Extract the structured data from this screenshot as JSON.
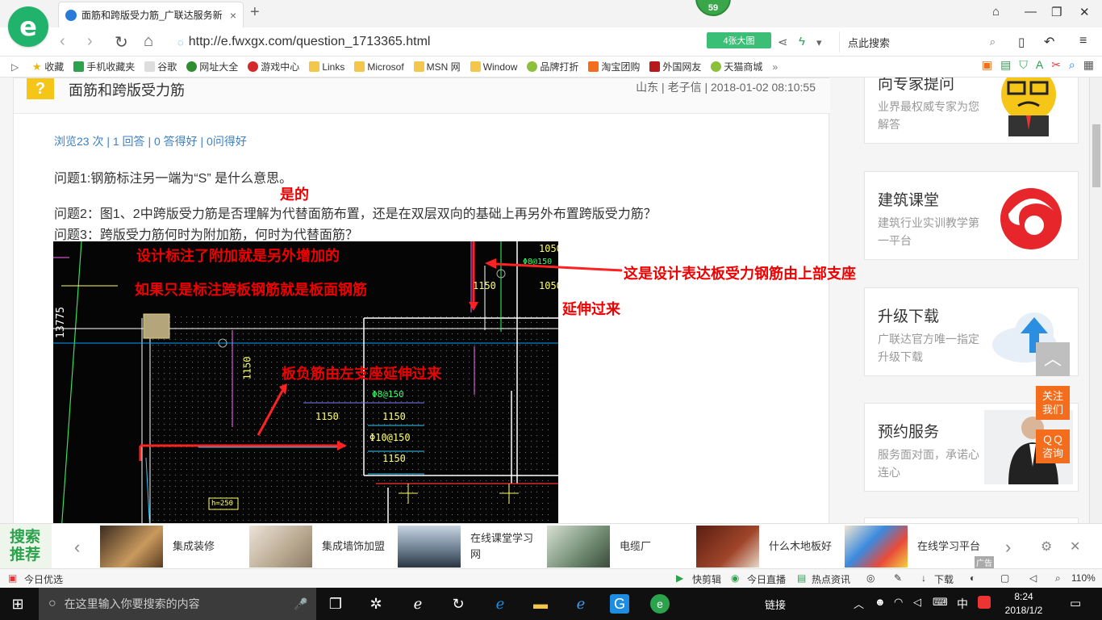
{
  "browser": {
    "tab_title": "面筋和跨版受力筋_广联达服务新",
    "notif_count": "59",
    "url": "http://e.fwxgx.com/question_1713365.html",
    "bigpic_label": "4张大图",
    "search_placeholder": "点此搜索"
  },
  "bookmarks": [
    {
      "label": "收藏"
    },
    {
      "label": "手机收藏夹"
    },
    {
      "label": "谷歌"
    },
    {
      "label": "网址大全"
    },
    {
      "label": "游戏中心"
    },
    {
      "label": "Links"
    },
    {
      "label": "Microsof"
    },
    {
      "label": "MSN 网"
    },
    {
      "label": "Window"
    },
    {
      "label": "品牌打折"
    },
    {
      "label": "淘宝团购"
    },
    {
      "label": "外国网友"
    },
    {
      "label": "天猫商城"
    }
  ],
  "question": {
    "title": "面筋和跨版受力筋",
    "meta": "山东 | 老子信 | 2018-01-02 08:10:55",
    "stats": "浏览23 次 | 1 回答 | 0 答得好 | 0问得好",
    "q1": "问题1:钢筋标注另一端为“S” 是什么意思。",
    "q2": "问题2：图1、2中跨版受力筋是否理解为代替面筋布置，还是在双层双向的基础上再另外布置跨版受力筋？",
    "q3": "问题3：跨版受力筋何时为附加筋，何时为代替面筋？"
  },
  "annotations": {
    "a_yes": "是的",
    "a_design1": "设计标注了附加就是另外增加的",
    "a_design2": "如果只是标注跨板钢筋就是板面钢筋",
    "a_upper": "这是设计表达板受力钢筋由上部支座",
    "a_extend": "延伸过来",
    "a_left": "板负筋由左支座延伸过来"
  },
  "cad": {
    "dim_13775": "13775",
    "dim_1050a": "1050",
    "dim_1050b": "1050",
    "dim_1150a": "1150",
    "dim_1150b": "1150",
    "dim_1150c": "1150",
    "dim_1150d": "1150",
    "dim_1150e": "1150",
    "rebar_a": "Φ10@150",
    "rebar_b": "Φ8@150",
    "rebar_c": "Φ8@150",
    "h_label": "h=250"
  },
  "sidebar": [
    {
      "title": "向专家提问",
      "desc": "业界最权威专家为您解答"
    },
    {
      "title": "建筑课堂",
      "desc": "建筑行业实训教学第一平台"
    },
    {
      "title": "升级下载",
      "desc": "广联达官方唯一指定升级下载"
    },
    {
      "title": "预约服务",
      "desc": "服务面对面，承诺心连心"
    }
  ],
  "float": {
    "follow": "关注\n我们",
    "qq": "ＱＱ\n咨询"
  },
  "adbar": {
    "label": "搜索\n推荐",
    "items": [
      {
        "label": "集成装修"
      },
      {
        "label": "集成墙饰加盟"
      },
      {
        "label": "在线课堂学习网"
      },
      {
        "label": "电缆厂"
      },
      {
        "label": "什么木地板好"
      },
      {
        "label": "在线学习平台"
      }
    ],
    "ad_tag": "广告"
  },
  "statusbar": {
    "left": "今日优选",
    "kuaijianji": "快剪辑",
    "zhibo": "今日直播",
    "redian": "热点资讯",
    "download": "下载",
    "zoom": "110%"
  },
  "taskbar": {
    "search_placeholder": "在这里输入你要搜索的内容",
    "link_label": "链接",
    "ime": "中",
    "time": "8:24",
    "date": "2018/1/2"
  },
  "colors": {
    "accent_green": "#21b26b",
    "link_blue": "#3e7fc4",
    "annotation_red": "#ee0000",
    "float_orange": "#f36d1d"
  }
}
